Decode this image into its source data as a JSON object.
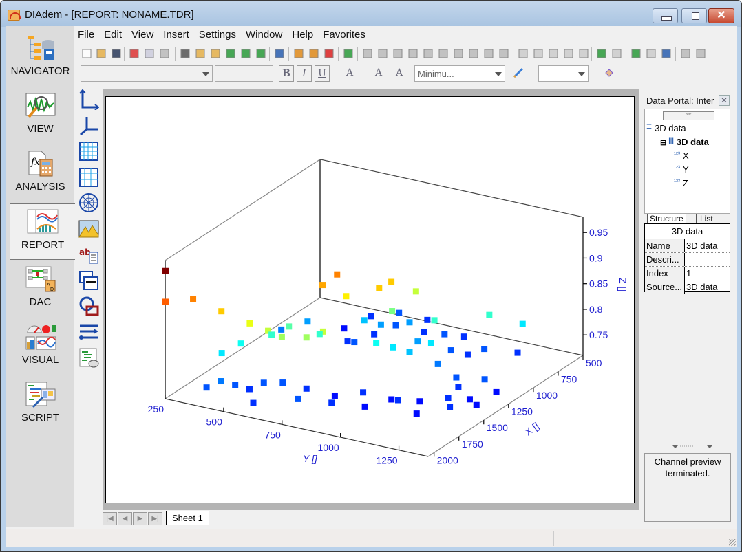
{
  "window": {
    "title": "DIAdem - [REPORT:   NONAME.TDR]",
    "close_glyph": "✕"
  },
  "menu": [
    "File",
    "Edit",
    "View",
    "Insert",
    "Settings",
    "Window",
    "Help",
    "Favorites"
  ],
  "navigator": [
    {
      "label": "NAVIGATOR",
      "icon": "navigator-icon"
    },
    {
      "label": "VIEW",
      "icon": "view-icon"
    },
    {
      "label": "ANALYSIS",
      "icon": "analysis-icon"
    },
    {
      "label": "REPORT",
      "icon": "report-icon",
      "active": true
    },
    {
      "label": "DAC",
      "icon": "dac-icon"
    },
    {
      "label": "VISUAL",
      "icon": "visual-icon"
    },
    {
      "label": "SCRIPT",
      "icon": "script-icon"
    }
  ],
  "toolbar": {
    "font_combo": "",
    "size_combo": "",
    "bold": "B",
    "italic": "I",
    "underline": "U",
    "text_color": "A",
    "superscript": "A",
    "subscript": "A",
    "line_style_combo": "Minimu...",
    "line_width_combo": ""
  },
  "palette": [
    "2d-axis-icon",
    "3d-axis-icon",
    "table-icon",
    "table-alt-icon",
    "polar-icon",
    "3d-surface-icon",
    "text-icon",
    "user-table-icon",
    "shapes-icon",
    "line-arrow-icon",
    "script-report-icon"
  ],
  "sheet_tabs": {
    "active": "Sheet 1"
  },
  "portal": {
    "title": "Data Portal: Inter",
    "tree": [
      {
        "label": "3D data",
        "level": 0,
        "icon": "database-icon"
      },
      {
        "label": "3D data",
        "level": 1,
        "icon": "channel-group-icon",
        "bold": true
      },
      {
        "label": "X",
        "level": 2,
        "icon": "numeric-channel-icon"
      },
      {
        "label": "Y",
        "level": 2,
        "icon": "numeric-channel-icon"
      },
      {
        "label": "Z",
        "level": 2,
        "icon": "numeric-channel-icon"
      }
    ],
    "tabs": [
      "Structure",
      "List"
    ],
    "props_title": "3D data",
    "props": [
      {
        "k": "Name",
        "v": "3D data"
      },
      {
        "k": "Descri...",
        "v": ""
      },
      {
        "k": "Index",
        "v": "1"
      },
      {
        "k": "Source...",
        "v": "3D data"
      }
    ],
    "preview": "Channel preview terminated."
  },
  "chart_data": {
    "type": "scatter",
    "title": "",
    "xlabel": "X []",
    "ylabel": "Y []",
    "zlabel": "Z []",
    "xlim": [
      500,
      2060
    ],
    "ylim": [
      250,
      1375
    ],
    "zlim": [
      0.71,
      0.96
    ],
    "x_ticks": [
      500,
      750,
      1000,
      1250,
      1500,
      1750,
      2000
    ],
    "y_ticks": [
      250,
      500,
      750,
      1000,
      1250
    ],
    "z_ticks": [
      0.75,
      0.8,
      0.85,
      0.9,
      0.95
    ],
    "colormap": "jet (low=blue, high=red)",
    "grid": false,
    "points": [
      [
        2060,
        250,
        0.96
      ],
      [
        2060,
        250,
        0.9
      ],
      [
        1900,
        300,
        0.89
      ],
      [
        1850,
        400,
        0.87
      ],
      [
        1800,
        500,
        0.85
      ],
      [
        1780,
        570,
        0.84
      ],
      [
        1760,
        620,
        0.83
      ],
      [
        1700,
        700,
        0.83
      ],
      [
        1650,
        750,
        0.84
      ],
      [
        1350,
        620,
        0.88
      ],
      [
        1250,
        640,
        0.89
      ],
      [
        1300,
        700,
        0.86
      ],
      [
        1180,
        790,
        0.87
      ],
      [
        1080,
        800,
        0.87
      ],
      [
        1120,
        820,
        0.82
      ],
      [
        950,
        850,
        0.84
      ],
      [
        1000,
        950,
        0.8
      ],
      [
        1450,
        650,
        0.8
      ],
      [
        1500,
        540,
        0.81
      ],
      [
        1580,
        500,
        0.8
      ],
      [
        1700,
        420,
        0.79
      ],
      [
        1800,
        380,
        0.78
      ],
      [
        1350,
        850,
        0.79
      ],
      [
        1300,
        900,
        0.78
      ],
      [
        1250,
        950,
        0.77
      ],
      [
        1150,
        1000,
        0.78
      ],
      [
        1200,
        1050,
        0.75
      ],
      [
        800,
        1100,
        0.8
      ],
      [
        700,
        1200,
        0.78
      ],
      [
        1250,
        1150,
        0.74
      ],
      [
        1300,
        1180,
        0.73
      ],
      [
        1200,
        1250,
        0.74
      ],
      [
        1050,
        900,
        0.76
      ],
      [
        950,
        1000,
        0.74
      ],
      [
        900,
        1050,
        0.73
      ],
      [
        850,
        1100,
        0.74
      ],
      [
        750,
        1200,
        0.73
      ],
      [
        1000,
        650,
        0.77
      ],
      [
        950,
        700,
        0.76
      ],
      [
        850,
        780,
        0.76
      ],
      [
        780,
        900,
        0.74
      ],
      [
        700,
        950,
        0.73
      ],
      [
        1200,
        1300,
        0.72
      ],
      [
        1350,
        1250,
        0.72
      ],
      [
        1450,
        1200,
        0.73
      ],
      [
        1500,
        1100,
        0.72
      ],
      [
        1550,
        1000,
        0.72
      ],
      [
        1600,
        900,
        0.73
      ],
      [
        1650,
        800,
        0.72
      ],
      [
        1700,
        700,
        0.73
      ],
      [
        1750,
        620,
        0.74
      ],
      [
        1800,
        560,
        0.74
      ],
      [
        1850,
        520,
        0.73
      ],
      [
        1900,
        480,
        0.74
      ],
      [
        1950,
        440,
        0.75
      ],
      [
        2000,
        400,
        0.74
      ],
      [
        1100,
        650,
        0.74
      ],
      [
        1050,
        600,
        0.73
      ],
      [
        900,
        650,
        0.73
      ],
      [
        800,
        700,
        0.74
      ],
      [
        750,
        800,
        0.73
      ],
      [
        850,
        500,
        0.72
      ],
      [
        700,
        550,
        0.73
      ],
      [
        650,
        650,
        0.74
      ],
      [
        600,
        750,
        0.73
      ],
      [
        1400,
        1300,
        0.72
      ],
      [
        1550,
        1250,
        0.73
      ],
      [
        1650,
        1150,
        0.72
      ],
      [
        1600,
        1050,
        0.73
      ],
      [
        1700,
        950,
        0.72
      ],
      [
        1800,
        850,
        0.73
      ],
      [
        1900,
        750,
        0.74
      ],
      [
        2000,
        600,
        0.73
      ],
      [
        1100,
        450,
        0.76
      ],
      [
        1200,
        380,
        0.75
      ]
    ]
  }
}
